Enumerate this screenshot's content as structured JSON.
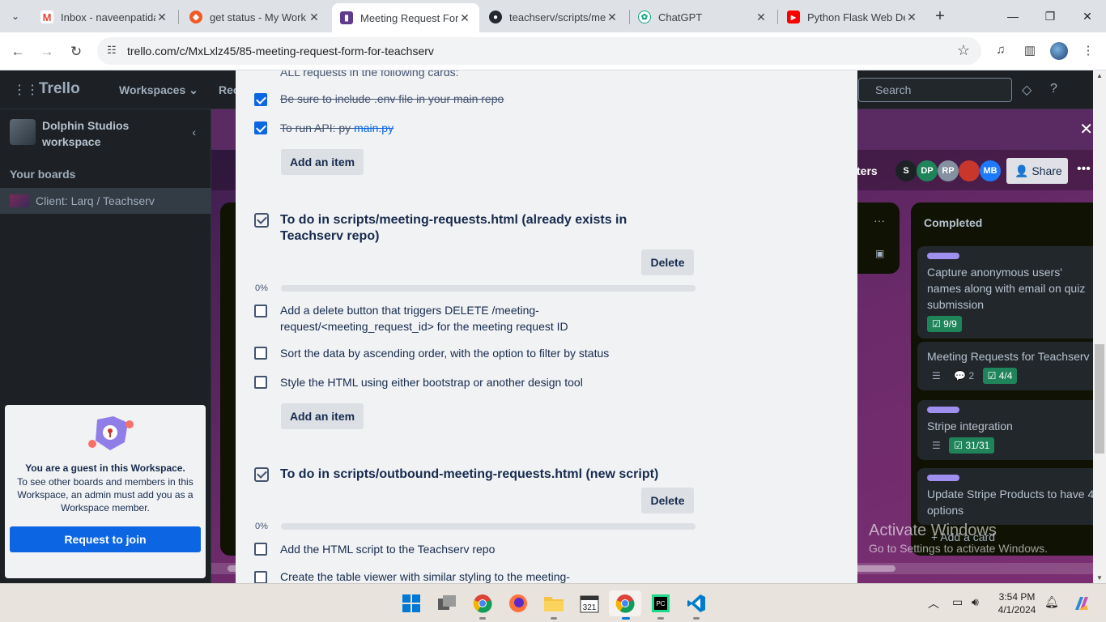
{
  "browser": {
    "tabs": [
      {
        "title": "Inbox - naveenpatida",
        "icon": "gmail-icon"
      },
      {
        "title": "get status - My Work",
        "icon": "clickup-icon"
      },
      {
        "title": "Meeting Request Forr",
        "icon": "trello-icon"
      },
      {
        "title": "teachserv/scripts/me",
        "icon": "github-icon"
      },
      {
        "title": "ChatGPT",
        "icon": "chatgpt-icon"
      },
      {
        "title": "Python Flask Web De",
        "icon": "youtube-icon"
      }
    ],
    "url": "trello.com/c/MxLxlz45/85-meeting-request-form-for-teachserv"
  },
  "trello": {
    "logo": "Trello",
    "nav": {
      "workspaces": "Workspaces",
      "recent": "Rec"
    },
    "search_placeholder": "Search",
    "workspace_name": "Dolphin Studios workspace",
    "your_boards": "Your boards",
    "board_name": "Client: Larq / Teachserv",
    "guest": {
      "title": "You are a guest in this Workspace.",
      "body": "To see other boards and members in this Workspace, an admin must add you as a Workspace member.",
      "join": "Request to join"
    },
    "board_header": {
      "filters": "ters",
      "share": "Share",
      "members": [
        {
          "initials": "S",
          "color": "#1d2125"
        },
        {
          "initials": "DP",
          "color": "#1f845a"
        },
        {
          "initials": "RP",
          "color": "#8590a2"
        },
        {
          "initials": "",
          "color": "#c9372c"
        },
        {
          "initials": "MB",
          "color": "#1d7afc"
        }
      ]
    },
    "completed_list": {
      "title": "Completed",
      "cards": [
        {
          "text": "Capture anonymous users' names along with email on quiz submission",
          "badge": "9/9"
        },
        {
          "text": "Meeting Requests for Teachserv",
          "comments": "2",
          "badge": "4/4"
        },
        {
          "text": "Stripe integration",
          "badge": "31/31"
        },
        {
          "text": "Update Stripe Products to have 4 options"
        }
      ],
      "add_card": "+ Add a card"
    }
  },
  "modal": {
    "intro_text": "ALL requests in the following cards:",
    "checklist1_items": [
      {
        "text": "Be sure to include .env file in your main repo",
        "checked": true
      },
      {
        "text": "To run API: py ",
        "link": "main.py",
        "checked": true
      }
    ],
    "add_item": "Add an item",
    "delete": "Delete",
    "checklist2": {
      "title": "To do in scripts/meeting-requests.html (already exists in Teachserv repo)",
      "percent": "0%",
      "progress": 0,
      "items": [
        "Add a delete button that triggers DELETE /meeting-request/<meeting_request_id> for the meeting request ID",
        "Sort the data by ascending order, with the option to filter by status",
        "Style the HTML using either bootstrap or another design tool"
      ]
    },
    "checklist3": {
      "title": "To do in scripts/outbound-meeting-requests.html (new script)",
      "percent": "0%",
      "progress": 0,
      "items": [
        "Add the HTML script to the Teachserv repo",
        "Create the table viewer with similar styling to the meeting-"
      ]
    }
  },
  "watermark": {
    "line1": "Activate Windows",
    "line2": "Go to Settings to activate Windows."
  },
  "taskbar": {
    "time": "3:54 PM",
    "date": "4/1/2024"
  }
}
